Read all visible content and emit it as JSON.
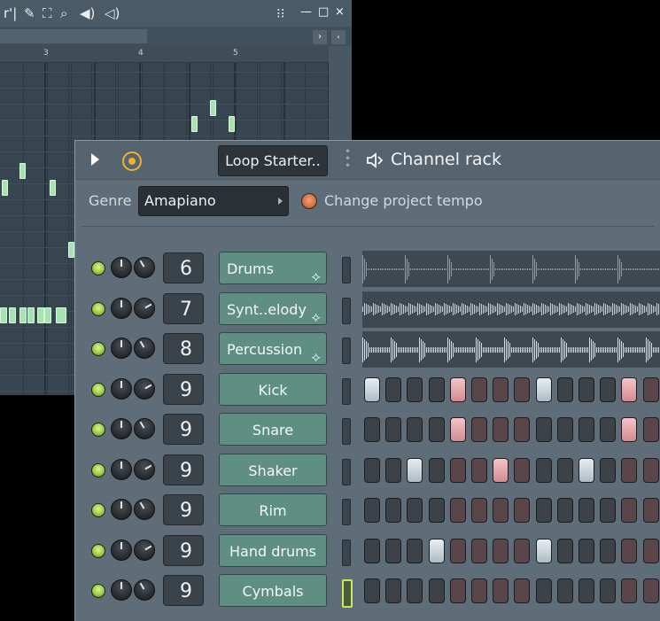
{
  "piano_roll": {
    "ruler_numbers": [
      "3",
      "4",
      "5"
    ],
    "window_buttons": {
      "minimize": "—",
      "maximize": "□",
      "close": "×"
    }
  },
  "channel_rack": {
    "preset_label": "Loop Starter..",
    "title": "Channel rack",
    "genre_label": "Genre",
    "genre_value": "Amapiano",
    "tempo_label": "Change project tempo",
    "channels": [
      {
        "name": "Drums",
        "number": "6",
        "type": "audio",
        "wave_color": "#d98080"
      },
      {
        "name": "Synt..elody",
        "number": "7",
        "type": "audio",
        "wave_color": "#f0c0c0"
      },
      {
        "name": "Percussion",
        "number": "8",
        "type": "audio",
        "wave_color": "#cfe8c0"
      },
      {
        "name": "Kick",
        "number": "9",
        "type": "steps",
        "steps": [
          1,
          0,
          0,
          0,
          2,
          0,
          0,
          0,
          1,
          0,
          0,
          0,
          2,
          0
        ]
      },
      {
        "name": "Snare",
        "number": "9",
        "type": "steps",
        "steps": [
          0,
          0,
          0,
          0,
          2,
          0,
          0,
          0,
          0,
          0,
          0,
          0,
          2,
          0
        ]
      },
      {
        "name": "Shaker",
        "number": "9",
        "type": "steps",
        "steps": [
          0,
          0,
          1,
          0,
          0,
          0,
          2,
          0,
          0,
          0,
          1,
          0,
          0,
          0
        ]
      },
      {
        "name": "Rim",
        "number": "9",
        "type": "steps",
        "steps": [
          0,
          0,
          0,
          0,
          0,
          0,
          0,
          0,
          0,
          0,
          0,
          0,
          0,
          0
        ]
      },
      {
        "name": "Hand drums",
        "number": "9",
        "type": "steps",
        "steps": [
          0,
          0,
          0,
          1,
          0,
          0,
          0,
          0,
          1,
          0,
          0,
          0,
          0,
          0
        ]
      },
      {
        "name": "Cymbals",
        "number": "9",
        "type": "steps",
        "steps": [
          0,
          0,
          0,
          0,
          0,
          0,
          0,
          0,
          0,
          0,
          0,
          0,
          0,
          0
        ]
      }
    ]
  }
}
